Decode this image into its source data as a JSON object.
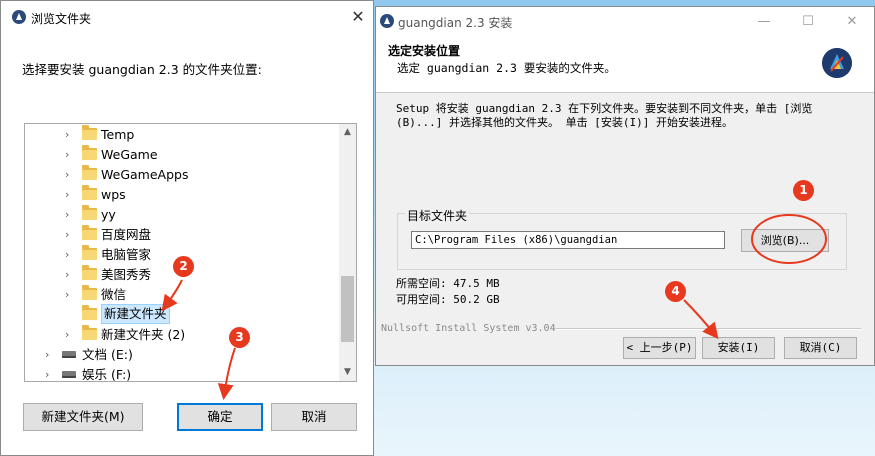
{
  "browse_dialog": {
    "title": "浏览文件夹",
    "close_glyph": "✕",
    "prompt": "选择要安装 guangdian 2.3 的文件夹位置:",
    "tree_items": [
      {
        "label": "Temp",
        "type": "folder",
        "expandable": true
      },
      {
        "label": "WeGame",
        "type": "folder",
        "expandable": true
      },
      {
        "label": "WeGameApps",
        "type": "folder",
        "expandable": true
      },
      {
        "label": "wps",
        "type": "folder",
        "expandable": true
      },
      {
        "label": "yy",
        "type": "folder",
        "expandable": true
      },
      {
        "label": "百度网盘",
        "type": "folder",
        "expandable": true
      },
      {
        "label": "电脑管家",
        "type": "folder",
        "expandable": true
      },
      {
        "label": "美图秀秀",
        "type": "folder",
        "expandable": true
      },
      {
        "label": "微信",
        "type": "folder",
        "expandable": true
      },
      {
        "label": "新建文件夹",
        "type": "folder",
        "expandable": false,
        "selected": true
      },
      {
        "label": "新建文件夹 (2)",
        "type": "folder",
        "expandable": true
      },
      {
        "label": "文档 (E:)",
        "type": "drive",
        "expandable": true
      },
      {
        "label": "娱乐 (F:)",
        "type": "drive",
        "expandable": true
      }
    ],
    "buttons": {
      "new_folder": "新建文件夹(M)",
      "ok": "确定",
      "cancel": "取消"
    }
  },
  "installer": {
    "title": "guangdian 2.3 安装",
    "minimize_glyph": "—",
    "maximize_glyph": "☐",
    "close_glyph": "✕",
    "header_title": "选定安装位置",
    "header_subtitle": "选定 guangdian 2.3 要安装的文件夹。",
    "description": "Setup 将安装 guangdian 2.3 在下列文件夹。要安装到不同文件夹，单击 [浏览(B)...] 并选择其他的文件夹。 单击 [安装(I)] 开始安装进程。",
    "dest_group_label": "目标文件夹",
    "dest_path": "C:\\Program Files (x86)\\guangdian",
    "browse_button": "浏览(B)...",
    "space_required": "所需空间: 47.5 MB",
    "space_available": "可用空间: 50.2 GB",
    "branding": "Nullsoft Install System v3.04",
    "buttons": {
      "back": "< 上一步(P)",
      "install": "安装(I)",
      "cancel": "取消(C)"
    }
  },
  "annotations": [
    "1",
    "2",
    "3",
    "4"
  ],
  "colors": {
    "annotation_red": "#e8391e",
    "selection_bg": "#cce8ff",
    "default_button_border": "#0078d7",
    "folder_yellow": "#f8d775"
  }
}
